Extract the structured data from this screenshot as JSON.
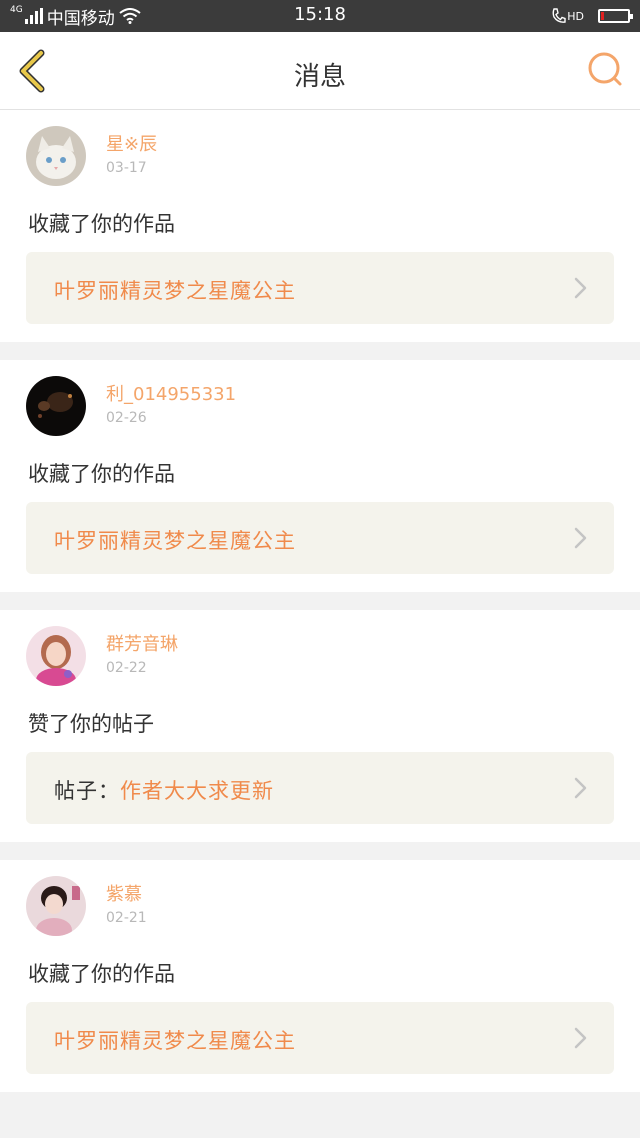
{
  "status_bar": {
    "network_sup": "4G",
    "carrier": "中国移动",
    "time": "15:18",
    "hd": "HD",
    "battery_level": 0.12,
    "battery_color": "#e02020"
  },
  "nav": {
    "title": "消息",
    "back_icon": "chevron-left-icon",
    "search_icon": "search-icon",
    "back_color": "#e8c84a",
    "search_color": "#f4a56a"
  },
  "colors": {
    "accent": "#f08a4b",
    "username": "#f4a56a",
    "date": "#b8b8b8"
  },
  "messages": [
    {
      "user": "星※辰",
      "date": "03-17",
      "action": "收藏了你的作品",
      "target_prefix": "",
      "target": "叶罗丽精灵梦之星魔公主"
    },
    {
      "user": "利_014955331",
      "date": "02-26",
      "action": "收藏了你的作品",
      "target_prefix": "",
      "target": "叶罗丽精灵梦之星魔公主"
    },
    {
      "user": "群芳音琳",
      "date": "02-22",
      "action": "赞了你的帖子",
      "target_prefix": "帖子：",
      "target": "作者大大求更新"
    },
    {
      "user": "紫慕",
      "date": "02-21",
      "action": "收藏了你的作品",
      "target_prefix": "",
      "target": "叶罗丽精灵梦之星魔公主"
    }
  ]
}
